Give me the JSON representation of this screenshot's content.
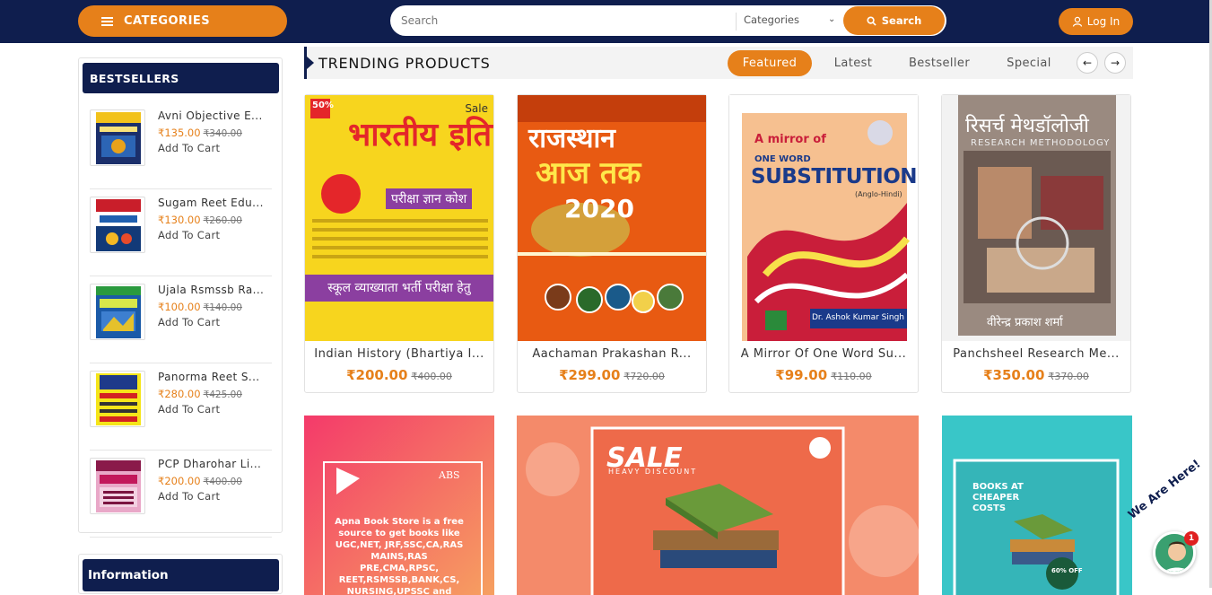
{
  "header": {
    "categories_label": "CATEGORIES",
    "search_placeholder": "Search",
    "search_category": "Categories",
    "search_button": "Search",
    "login_button": "Log In"
  },
  "sidebar": {
    "title": "BESTSELLERS",
    "items": [
      {
        "name": "Avni Objective E...",
        "price": "₹135.00",
        "old_price": "₹340.00",
        "cart": "Add To Cart"
      },
      {
        "name": "Sugam Reet Edu...",
        "price": "₹130.00",
        "old_price": "₹260.00",
        "cart": "Add To Cart"
      },
      {
        "name": "Ujala Rsmssb Ra...",
        "price": "₹100.00",
        "old_price": "₹140.00",
        "cart": "Add To Cart"
      },
      {
        "name": "Panorma Reet S...",
        "price": "₹280.00",
        "old_price": "₹425.00",
        "cart": "Add To Cart"
      },
      {
        "name": "PCP Dharohar Li...",
        "price": "₹200.00",
        "old_price": "₹400.00",
        "cart": "Add To Cart"
      }
    ],
    "info_title": "Information"
  },
  "trending": {
    "title": "TRENDING PRODUCTS",
    "tabs": [
      "Featured",
      "Latest",
      "Bestseller",
      "Special"
    ],
    "prev": "←",
    "next": "→"
  },
  "products": [
    {
      "name": "Indian History (Bhartiya I...",
      "price": "₹200.00",
      "old_price": "₹400.00",
      "badge": "Sale",
      "cover_title": "भारतीय इतिहास",
      "cover_sub": "परीक्षा ज्ञान कोश",
      "cover_band": "स्कूल व्याख्याता भर्ती परीक्षा हेतु",
      "cover_pct": "50%"
    },
    {
      "name": "Aachaman Prakashan R...",
      "price": "₹299.00",
      "old_price": "₹720.00",
      "cover_title": "राजस्थान",
      "cover_sub": "आज तक",
      "cover_year": "2020"
    },
    {
      "name": "A Mirror Of One Word Su...",
      "price": "₹99.00",
      "old_price": "₹110.00",
      "cover_pre": "A mirror of",
      "cover_small": "ONE WORD",
      "cover_title": "SUBSTITUTION",
      "cover_sub": "(Anglo-Hindi)",
      "cover_author": "Dr. Ashok Kumar Singh"
    },
    {
      "name": "Panchsheel Research Me...",
      "price": "₹350.00",
      "old_price": "₹370.00",
      "cover_title": "रिसर्च मेथडॉलोजी",
      "cover_sub": "RESEARCH METHODOLOGY",
      "cover_author": "वीरेन्द्र प्रकाश शर्मा"
    }
  ],
  "banners": {
    "left_brand": "ABS",
    "left_text": "Apna Book Store is a free source to get books like UGC,NET, JRF,SSC,CA,RAS MAINS,RAS PRE,CMA,RPSC, REET,RSMSSB,BANK,CS, NURSING,UPSSC and many more at a",
    "mid_title": "SALE",
    "mid_sub": "HEAVY DISCOUNT",
    "right_title": "BOOKS AT CHEAPER COSTS",
    "right_badge": "60% OFF"
  },
  "chat": {
    "label": "We Are Here!",
    "count": "1"
  },
  "colors": {
    "navy": "#0f1e4e",
    "orange": "#e6801a"
  }
}
